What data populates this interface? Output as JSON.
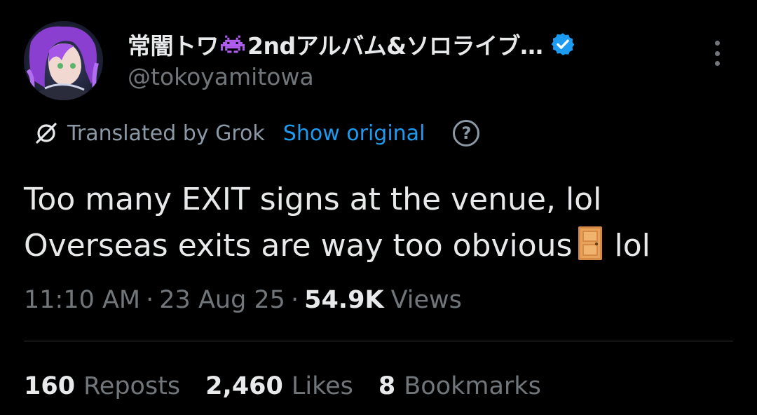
{
  "author": {
    "display_name": "常闇トワ",
    "display_name_suffix": "2ndアルバム&ソロライブ…",
    "display_name_emoji": "space-invader-icon",
    "handle": "@tokoyamitowa",
    "verified": true
  },
  "translation": {
    "label": "Translated by Grok",
    "show_original": "Show original",
    "help_glyph": "?"
  },
  "tweet": {
    "line1": "Too many EXIT signs at the venue, lol",
    "line2_before": "Overseas exits are way too obvious",
    "line2_emoji": "door-icon",
    "line2_after": "lol"
  },
  "meta": {
    "time": "11:10 AM",
    "sep": "·",
    "date": "23 Aug 25",
    "views_count": "54.9K",
    "views_label": "Views"
  },
  "stats": [
    {
      "count": "160",
      "label": "Reposts"
    },
    {
      "count": "2,460",
      "label": "Likes"
    },
    {
      "count": "8",
      "label": "Bookmarks"
    }
  ],
  "colors": {
    "background": "#000000",
    "text": "#e7e9ea",
    "secondary": "#71767b",
    "link": "#1d9bf0",
    "verified": "#1d9bf0",
    "divider": "#2f3336"
  }
}
